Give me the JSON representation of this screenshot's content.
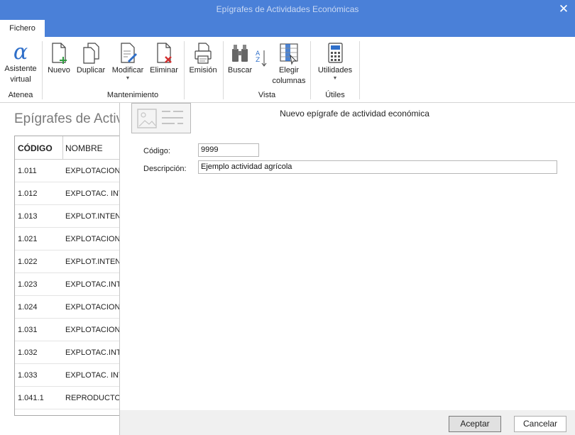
{
  "window": {
    "title": "Epígrafes de Actividades Económicas"
  },
  "tabs": {
    "fichero": "Fichero"
  },
  "ribbon": {
    "atenea": {
      "button": [
        "Asistente",
        "virtual"
      ],
      "group": "Atenea"
    },
    "mantenimiento": {
      "nuevo": "Nuevo",
      "duplicar": "Duplicar",
      "modificar": "Modificar",
      "eliminar": "Eliminar",
      "emision": "Emisión",
      "group": "Mantenimiento"
    },
    "vista": {
      "buscar": "Buscar",
      "elegir": [
        "Elegir",
        "columnas"
      ],
      "group": "Vista"
    },
    "utiles": {
      "utilidades": "Utilidades",
      "group": "Útiles"
    }
  },
  "list": {
    "title": "Epígrafes de Activ",
    "columns": [
      "CÓDIGO",
      "NOMBRE"
    ],
    "rows": [
      [
        "1.011",
        "EXPLOTACION"
      ],
      [
        "1.012",
        "EXPLOTAC. INT"
      ],
      [
        "1.013",
        "EXPLOT.INTEN"
      ],
      [
        "1.021",
        "EXPLOTACION"
      ],
      [
        "1.022",
        "EXPLOT.INTEN"
      ],
      [
        "1.023",
        "EXPLOTAC.INT"
      ],
      [
        "1.024",
        "EXPLOTACION"
      ],
      [
        "1.031",
        "EXPLOTACION"
      ],
      [
        "1.032",
        "EXPLOTAC.INT"
      ],
      [
        "1.033",
        "EXPLOTAC. INT"
      ],
      [
        "1.041.1",
        "REPRODUCTOR"
      ]
    ]
  },
  "dialog": {
    "title": "Nuevo epígrafe de actividad económica",
    "codigo_label": "Código:",
    "codigo_value": "9999",
    "descripcion_label": "Descripción:",
    "descripcion_value": "Ejemplo actividad agrícola",
    "accept": "Aceptar",
    "cancel": "Cancelar"
  },
  "colors": {
    "titlebar": "#4a80d8",
    "accent_green": "#2e9b3e",
    "accent_red": "#d32f2f",
    "accent_blue": "#2f6fc9"
  }
}
